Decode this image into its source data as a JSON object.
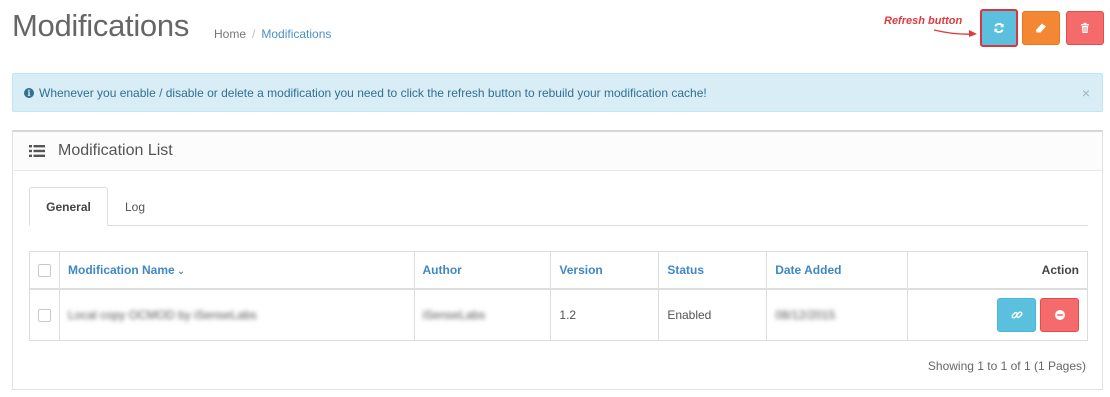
{
  "header": {
    "title": "Modifications",
    "breadcrumb": [
      {
        "label": "Home"
      },
      {
        "label": "Modifications"
      }
    ]
  },
  "annotation": {
    "label": "Refresh button",
    "color": "#e0393e"
  },
  "toolbar": {
    "buttons": [
      {
        "name": "refresh",
        "icon": "refresh-icon",
        "color": "#5bc0de"
      },
      {
        "name": "clear",
        "icon": "eraser-icon",
        "color": "#f38733"
      },
      {
        "name": "delete",
        "icon": "trash-icon",
        "color": "#f56b6b"
      }
    ]
  },
  "alert": {
    "icon": "info-circle-icon",
    "text": "Whenever you enable / disable or delete a modification you need to click the refresh button to rebuild your modification cache!",
    "close": "×"
  },
  "panel": {
    "icon": "list-icon",
    "title": "Modification List",
    "tabs": [
      {
        "label": "General",
        "active": true
      },
      {
        "label": "Log",
        "active": false
      }
    ]
  },
  "table": {
    "columns": {
      "name": "Modification Name",
      "author": "Author",
      "version": "Version",
      "status": "Status",
      "date_added": "Date Added",
      "action": "Action"
    },
    "sort_indicator": "chevron-down-icon",
    "rows": [
      {
        "name": "Local copy OCMOD by iSenseLabs",
        "author": "iSenseLabs",
        "version": "1.2",
        "status": "Enabled",
        "date_added": "08/12/2015",
        "actions": [
          "link-icon",
          "minus-circle-icon"
        ]
      }
    ]
  },
  "pagination": {
    "text": "Showing 1 to 1 of 1 (1 Pages)"
  },
  "colors": {
    "accent": "#3f88c5",
    "info_bg": "#d9edf7",
    "info_text": "#31708f"
  }
}
